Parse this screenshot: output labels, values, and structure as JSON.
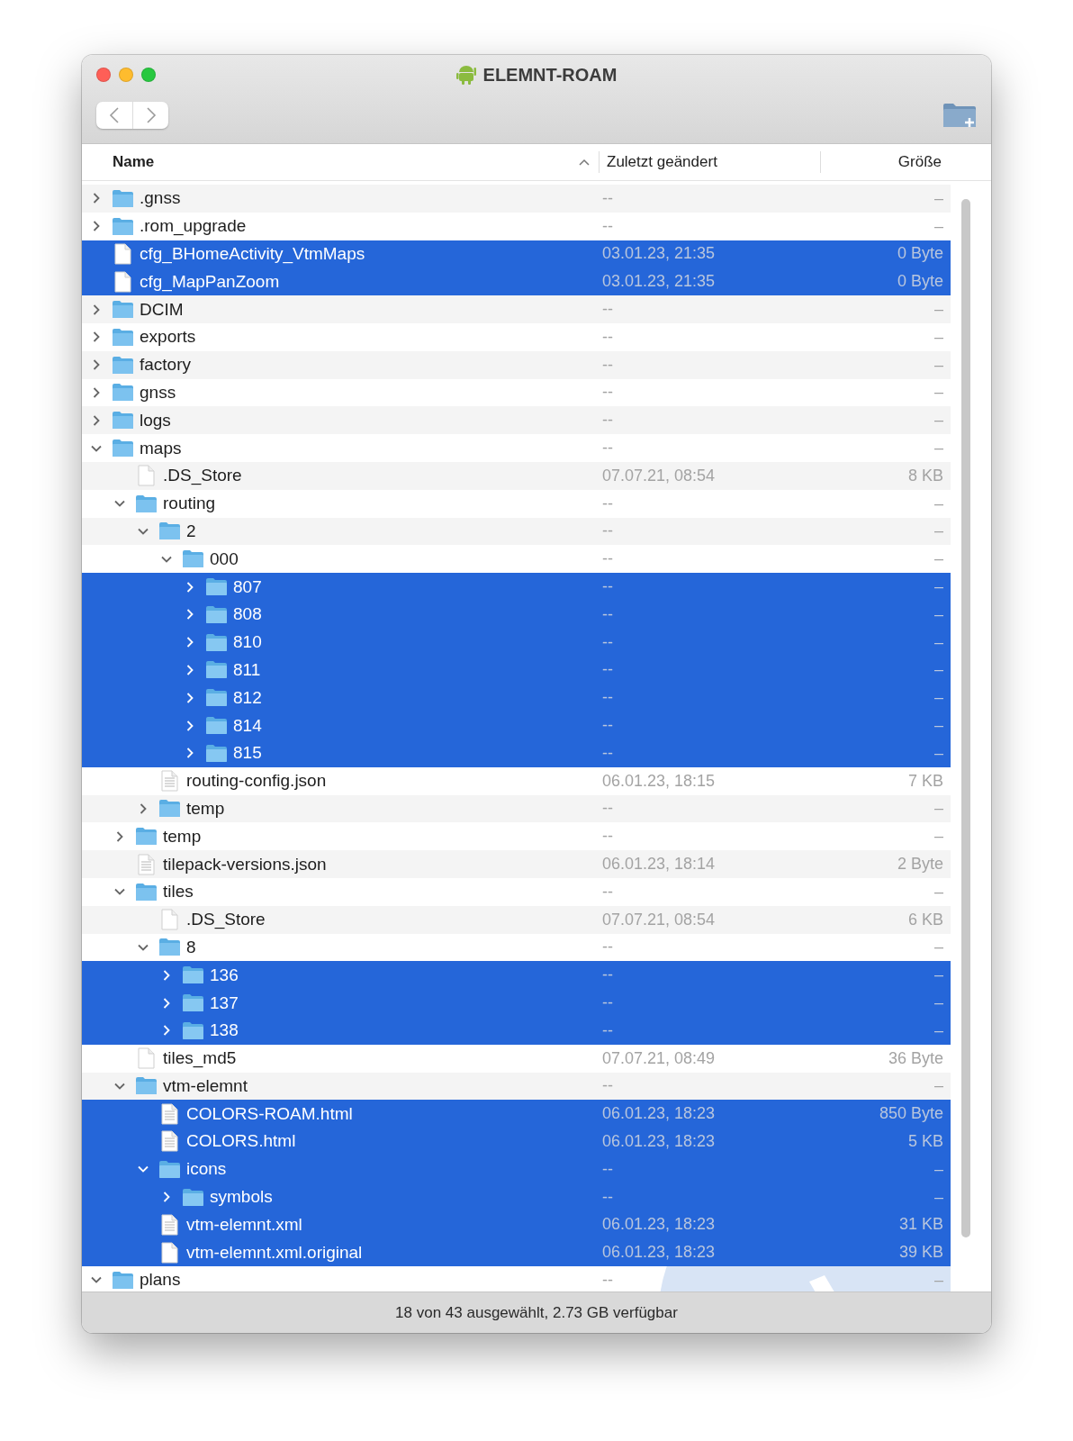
{
  "window": {
    "title": "ELEMNT-ROAM"
  },
  "columns": [
    {
      "label": "Name",
      "sorted": true
    },
    {
      "label": "Zuletzt geändert",
      "sorted": false
    },
    {
      "label": "Größe",
      "sorted": false
    }
  ],
  "rows": [
    {
      "name": ".gnss",
      "kind": "folder",
      "expanded": false,
      "selected": false,
      "modified": "--",
      "size": "–"
    },
    {
      "name": ".rom_upgrade",
      "kind": "folder",
      "expanded": false,
      "selected": false,
      "modified": "--",
      "size": "–"
    },
    {
      "name": "cfg_BHomeActivity_VtmMaps",
      "kind": "file",
      "selected": true,
      "modified": "03.01.23, 21:35",
      "size": "0 Byte"
    },
    {
      "name": "cfg_MapPanZoom",
      "kind": "file",
      "selected": true,
      "modified": "03.01.23, 21:35",
      "size": "0 Byte"
    },
    {
      "name": "DCIM",
      "kind": "folder",
      "expanded": false,
      "selected": false,
      "modified": "--",
      "size": "–"
    },
    {
      "name": "exports",
      "kind": "folder",
      "expanded": false,
      "selected": false,
      "modified": "--",
      "size": "–"
    },
    {
      "name": "factory",
      "kind": "folder",
      "expanded": false,
      "selected": false,
      "modified": "--",
      "size": "–"
    },
    {
      "name": "gnss",
      "kind": "folder",
      "expanded": false,
      "selected": false,
      "modified": "--",
      "size": "–"
    },
    {
      "name": "logs",
      "kind": "folder",
      "expanded": false,
      "selected": false,
      "modified": "--",
      "size": "–"
    },
    {
      "name": "maps",
      "kind": "folder",
      "expanded": true,
      "selected": false,
      "modified": "--",
      "size": "–",
      "children": [
        {
          "name": ".DS_Store",
          "kind": "file",
          "selected": false,
          "modified": "07.07.21, 08:54",
          "size": "8 KB"
        },
        {
          "name": "routing",
          "kind": "folder",
          "expanded": true,
          "selected": false,
          "modified": "--",
          "size": "–",
          "children": [
            {
              "name": "2",
              "kind": "folder",
              "expanded": true,
              "selected": false,
              "modified": "--",
              "size": "–",
              "children": [
                {
                  "name": "000",
                  "kind": "folder",
                  "expanded": true,
                  "selected": false,
                  "modified": "--",
                  "size": "–",
                  "children": [
                    {
                      "name": "807",
                      "kind": "folder",
                      "expanded": false,
                      "selected": true,
                      "modified": "--",
                      "size": "–"
                    },
                    {
                      "name": "808",
                      "kind": "folder",
                      "expanded": false,
                      "selected": true,
                      "modified": "--",
                      "size": "–"
                    },
                    {
                      "name": "810",
                      "kind": "folder",
                      "expanded": false,
                      "selected": true,
                      "modified": "--",
                      "size": "–"
                    },
                    {
                      "name": "811",
                      "kind": "folder",
                      "expanded": false,
                      "selected": true,
                      "modified": "--",
                      "size": "–"
                    },
                    {
                      "name": "812",
                      "kind": "folder",
                      "expanded": false,
                      "selected": true,
                      "modified": "--",
                      "size": "–"
                    },
                    {
                      "name": "814",
                      "kind": "folder",
                      "expanded": false,
                      "selected": true,
                      "modified": "--",
                      "size": "–"
                    },
                    {
                      "name": "815",
                      "kind": "folder",
                      "expanded": false,
                      "selected": true,
                      "modified": "--",
                      "size": "–"
                    }
                  ]
                }
              ]
            },
            {
              "name": "routing-config.json",
              "kind": "document",
              "selected": false,
              "modified": "06.01.23, 18:15",
              "size": "7 KB"
            },
            {
              "name": "temp",
              "kind": "folder",
              "expanded": false,
              "selected": false,
              "modified": "--",
              "size": "–"
            }
          ]
        },
        {
          "name": "temp",
          "kind": "folder",
          "expanded": false,
          "selected": false,
          "modified": "--",
          "size": "–"
        },
        {
          "name": "tilepack-versions.json",
          "kind": "document",
          "selected": false,
          "modified": "06.01.23, 18:14",
          "size": "2 Byte"
        },
        {
          "name": "tiles",
          "kind": "folder",
          "expanded": true,
          "selected": false,
          "modified": "--",
          "size": "–",
          "children": [
            {
              "name": ".DS_Store",
              "kind": "file",
              "selected": false,
              "modified": "07.07.21, 08:54",
              "size": "6 KB"
            },
            {
              "name": "8",
              "kind": "folder",
              "expanded": true,
              "selected": false,
              "modified": "--",
              "size": "–",
              "children": [
                {
                  "name": "136",
                  "kind": "folder",
                  "expanded": false,
                  "selected": true,
                  "modified": "--",
                  "size": "–"
                },
                {
                  "name": "137",
                  "kind": "folder",
                  "expanded": false,
                  "selected": true,
                  "modified": "--",
                  "size": "–"
                },
                {
                  "name": "138",
                  "kind": "folder",
                  "expanded": false,
                  "selected": true,
                  "modified": "--",
                  "size": "–"
                }
              ]
            }
          ]
        },
        {
          "name": "tiles_md5",
          "kind": "file",
          "selected": false,
          "modified": "07.07.21, 08:49",
          "size": "36 Byte"
        },
        {
          "name": "vtm-elemnt",
          "kind": "folder",
          "expanded": true,
          "selected": false,
          "modified": "--",
          "size": "–",
          "children": [
            {
              "name": "COLORS-ROAM.html",
              "kind": "document",
              "selected": true,
              "modified": "06.01.23, 18:23",
              "size": "850 Byte"
            },
            {
              "name": "COLORS.html",
              "kind": "document",
              "selected": true,
              "modified": "06.01.23, 18:23",
              "size": "5 KB"
            },
            {
              "name": "icons",
              "kind": "folder",
              "expanded": true,
              "selected": true,
              "modified": "--",
              "size": "–",
              "children": [
                {
                  "name": "symbols",
                  "kind": "folder",
                  "expanded": false,
                  "selected": true,
                  "modified": "--",
                  "size": "–"
                }
              ]
            },
            {
              "name": "vtm-elemnt.xml",
              "kind": "document",
              "selected": true,
              "modified": "06.01.23, 18:23",
              "size": "31 KB"
            },
            {
              "name": "vtm-elemnt.xml.original",
              "kind": "file",
              "selected": true,
              "modified": "06.01.23, 18:23",
              "size": "39 KB"
            }
          ]
        }
      ]
    },
    {
      "name": "plans",
      "kind": "folder",
      "expanded": true,
      "selected": false,
      "modified": "--",
      "size": "–"
    }
  ],
  "status_bar": "18 von 43 ausgewählt, 2.73 GB verfügbar"
}
